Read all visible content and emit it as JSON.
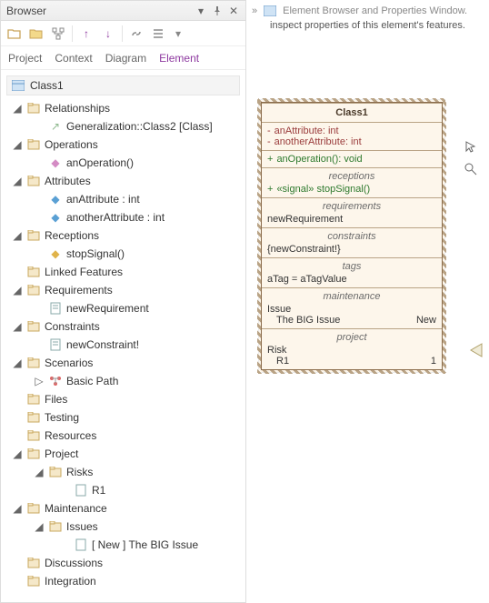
{
  "pane": {
    "title": "Browser"
  },
  "tabs": {
    "project": "Project",
    "context": "Context",
    "diagram": "Diagram",
    "element": "Element"
  },
  "tree": {
    "root": "Class1",
    "relationships": {
      "label": "Relationships",
      "item": "Generalization::Class2 [Class]"
    },
    "operations": {
      "label": "Operations",
      "item": "anOperation()"
    },
    "attributes": {
      "label": "Attributes",
      "a1": "anAttribute : int",
      "a2": "anotherAttribute : int"
    },
    "receptions": {
      "label": "Receptions",
      "item": "stopSignal()"
    },
    "linked": {
      "label": "Linked Features"
    },
    "requirements": {
      "label": "Requirements",
      "item": "newRequirement"
    },
    "constraints": {
      "label": "Constraints",
      "item": "newConstraint!"
    },
    "scenarios": {
      "label": "Scenarios",
      "item": "Basic Path"
    },
    "files": {
      "label": "Files"
    },
    "testing": {
      "label": "Testing"
    },
    "resources": {
      "label": "Resources"
    },
    "project": {
      "label": "Project",
      "risks": "Risks",
      "r1": "R1"
    },
    "maintenance": {
      "label": "Maintenance",
      "issues": "Issues",
      "issue1": "[ New ] The BIG Issue"
    },
    "discussions": {
      "label": "Discussions"
    },
    "integration": {
      "label": "Integration"
    }
  },
  "right": {
    "header": "Element Browser and Properties Window.",
    "sub": "inspect properties of this element's features."
  },
  "class": {
    "name": "Class1",
    "attr1": "anAttribute: int",
    "attr2": "anotherAttribute: int",
    "op1": "anOperation(): void",
    "receptions_title": "receptions",
    "recep1": "«signal» stopSignal()",
    "requirements_title": "requirements",
    "req1": "newRequirement",
    "constraints_title": "constraints",
    "con1": "{newConstraint!}",
    "tags_title": "tags",
    "tag1": "aTag = aTagValue",
    "maintenance_title": "maintenance",
    "issue_lbl": "Issue",
    "issue_name": "The BIG Issue",
    "issue_status": "New",
    "project_title": "project",
    "risk_lbl": "Risk",
    "risk_name": "R1",
    "risk_val": "1"
  }
}
